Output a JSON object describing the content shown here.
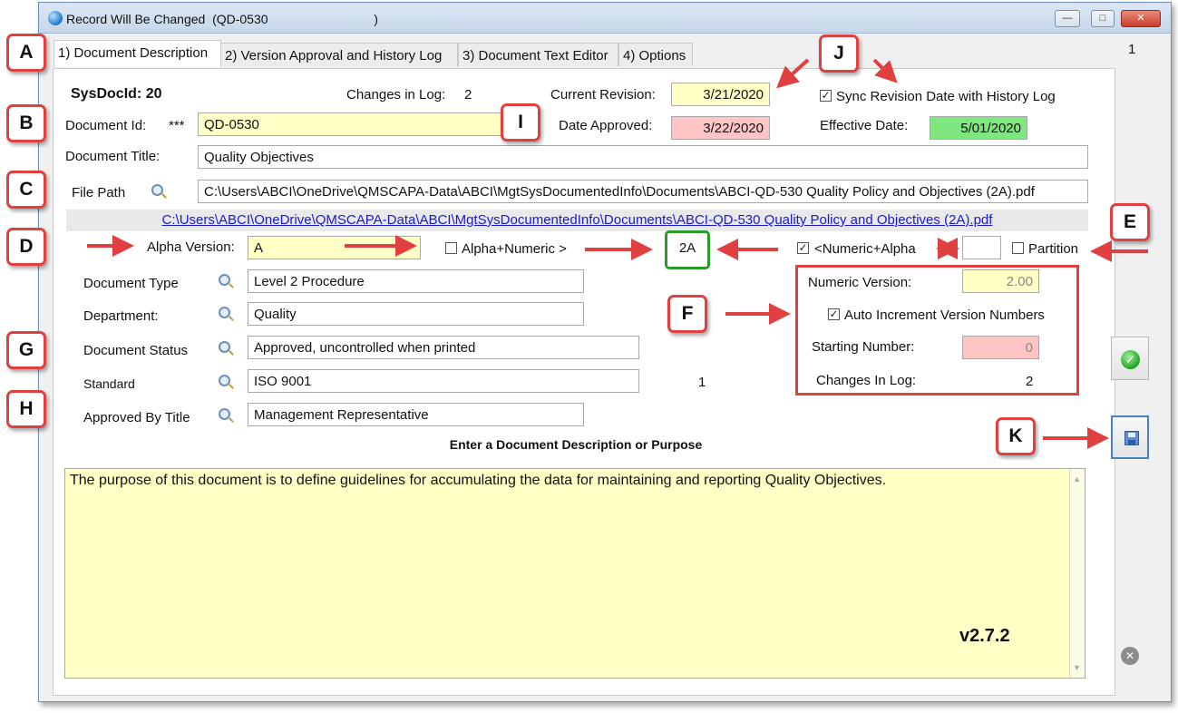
{
  "window": {
    "title": "Record Will Be Changed  (QD-0530                              )"
  },
  "tabs": [
    {
      "label": "1) Document Description"
    },
    {
      "label": "2) Version Approval and History Log"
    },
    {
      "label": "3) Document Text Editor"
    },
    {
      "label": "4) Options"
    }
  ],
  "record_counter": "1",
  "header": {
    "sysdocid": "SysDocId: 20",
    "changes_label": "Changes in Log:",
    "changes_value": "2",
    "current_revision_label": "Current Revision:",
    "current_revision": "3/21/2020",
    "sync_label": "Sync Revision Date with History Log",
    "date_approved_label": "Date Approved:",
    "date_approved": "3/22/2020",
    "effective_date_label": "Effective Date:",
    "effective_date": "5/01/2020"
  },
  "document": {
    "id_label": "Document Id:",
    "id_required": "***",
    "id": "QD-0530",
    "title_label": "Document Title:",
    "title": "Quality Objectives",
    "file_path_label": "File Path",
    "file_path": "C:\\Users\\ABCI\\OneDrive\\QMSCAPA-Data\\ABCI\\MgtSysDocumentedInfo\\Documents\\ABCI-QD-530 Quality Policy and Objectives (2A).pdf",
    "file_link": "C:\\Users\\ABCI\\OneDrive\\QMSCAPA-Data\\ABCI\\MgtSysDocumentedInfo\\Documents\\ABCI-QD-530 Quality Policy and Objectives (2A).pdf"
  },
  "version": {
    "alpha_label": "Alpha Version:",
    "alpha": "A",
    "alpha_numeric_label": "Alpha+Numeric >",
    "combined": "2A",
    "numeric_alpha_label": "<Numeric+Alpha",
    "partition_value": "",
    "partition_label": "Partition",
    "numeric_version_label": "Numeric Version:",
    "numeric_version": "2.00",
    "auto_increment_label": "Auto Increment Version Numbers",
    "starting_number_label": "Starting Number:",
    "starting_number": "0",
    "changes_in_log_label": "Changes In Log:",
    "changes_in_log": "2"
  },
  "classification": {
    "type_label": "Document Type",
    "type": "Level 2 Procedure",
    "department_label": "Department:",
    "department": "Quality",
    "status_label": "Document Status",
    "status": "Approved, uncontrolled when printed",
    "standard_label": "Standard",
    "standard": "ISO 9001",
    "standard_count": "1",
    "approved_by_label": "Approved By Title",
    "approved_by": "Management Representative"
  },
  "description": {
    "heading": "Enter a Document Description or Purpose",
    "text": "The purpose of this document is to define guidelines for accumulating the data for maintaining and reporting Quality Objectives.",
    "version_tag": "v2.7.2"
  },
  "callouts": [
    "A",
    "B",
    "C",
    "D",
    "E",
    "F",
    "G",
    "H",
    "I",
    "J",
    "K"
  ],
  "icons": {
    "app": "globe-icon",
    "lookup": "magnifier-icon",
    "ok": "green-check-icon",
    "save": "floppy-disk-icon",
    "cancel": "gray-x-icon"
  },
  "colors": {
    "required_field": "#ffffc6",
    "date_approved": "#ffc4c4",
    "effective_date": "#7fe77f",
    "callout_border": "#e04040",
    "link": "#1a1ad6"
  }
}
